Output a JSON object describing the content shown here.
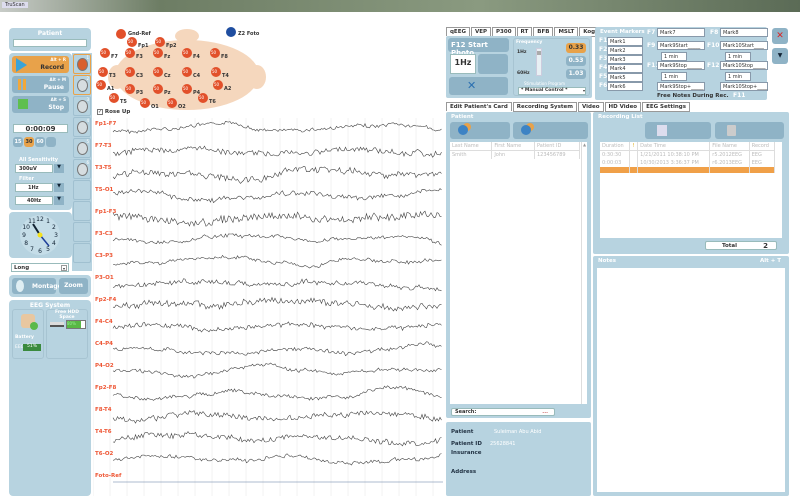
{
  "window": {
    "title": "TruScan"
  },
  "left": {
    "patient_label": "Patient",
    "patient_value": "",
    "record": {
      "label": "Record",
      "shortcut": "Alt + R"
    },
    "pause": {
      "label": "Pause",
      "shortcut": "Alt + M"
    },
    "stop": {
      "label": "Stop",
      "shortcut": "Alt + S"
    },
    "timer": "0:00:09",
    "timebase": [
      "15",
      "30",
      "60",
      ""
    ],
    "timebase_selected": "30",
    "sensitivity_label": "All Sensitivity",
    "sensitivity": "300uV",
    "filter_label": "Filter",
    "low_filter": "1Hz",
    "high_filter": "40Hz",
    "clock_numbers": [
      "12",
      "1",
      "2",
      "3",
      "4",
      "5",
      "6",
      "7",
      "8",
      "9",
      "10",
      "11"
    ],
    "mode": "Long",
    "montage": "Montage",
    "zoom": "Zoom",
    "eeg_system": "EEG System",
    "battery_label": "Battery",
    "battery_value": "51%",
    "battery_prefix": "EEG",
    "hdd_label": "Free HDD Space",
    "hdd_value": "80%"
  },
  "montage_icons": [
    "1",
    "2",
    "3",
    "4",
    "5",
    "6"
  ],
  "head": {
    "gnd": "Gnd-Ref",
    "foto": "Z2 Foto",
    "rose_up": "Rose Up",
    "rose_up_checked": true,
    "electrodes": [
      "Fp1",
      "Fp2",
      "F7",
      "F3",
      "Fz",
      "F4",
      "F8",
      "T3",
      "C3",
      "Cz",
      "C4",
      "T4",
      "A1",
      "P3",
      "Pz",
      "P4",
      "A2",
      "T5",
      "T6",
      "O1",
      "O2"
    ],
    "electrode_value": "50"
  },
  "channels": [
    "Fp1-F7",
    "F7-T3",
    "T3-T5",
    "T5-O1",
    "Fp1-F3",
    "F3-C3",
    "C3-P3",
    "P3-O1",
    "Fp2-F4",
    "F4-C4",
    "C4-P4",
    "P4-O2",
    "Fp2-F8",
    "F8-T4",
    "T4-T6",
    "T6-O2",
    "Foto-Ref"
  ],
  "stim": {
    "tabs": [
      "qEEG",
      "VEP",
      "P300",
      "RT",
      "BFB",
      "MSLT",
      "Kogn."
    ],
    "photo": "F12 Start Photo",
    "freq_value": "1Hz",
    "frequency_label": "Frequency",
    "freq_min": "1Hz",
    "freq_max": "60Hz",
    "values": [
      "0.33",
      "0.53",
      "1.03"
    ],
    "selected": "0.33",
    "program_label": "Stimulation Program",
    "program": "* Manual Control *"
  },
  "markers": {
    "title": "Event Markers",
    "keys": [
      "F1",
      "F2",
      "F3",
      "F4",
      "F5",
      "F6"
    ],
    "items": [
      "Mark1",
      "Mark2",
      "Mark3",
      "Mark4",
      "Mark5",
      "Mark6"
    ],
    "f7": "F7",
    "mark7": "Mark7",
    "f8": "F8",
    "mark8": "Mark8",
    "f9": "F9",
    "mark9start": "Mark9Start_____",
    "f10": "F10",
    "mark10start": "Mark10Start____",
    "dur": "1 min",
    "f11a": "F11",
    "mark9stop": "Mark9Stop______",
    "f12a": "F12",
    "mark10stop": "Mark10Stop_____",
    "mark9stopp": "Mark9Stop+_____",
    "mark10stopp": "Mark10Stop+____",
    "free_notes": "Free Notes During Rec.",
    "free_key": "F11"
  },
  "tabs": [
    "Edit Patient's Card",
    "Recording System",
    "Video",
    "HD Video",
    "EEG Settings"
  ],
  "patient_panel": {
    "title": "Patient",
    "columns": [
      "Last Name",
      "First Name",
      "Patient ID"
    ],
    "rows": [
      [
        "Smith",
        "John",
        "123456789"
      ]
    ],
    "search_label": "Search:",
    "search_value": "..."
  },
  "recording": {
    "title": "Recording List",
    "columns": [
      "Duration",
      "!",
      "Date Time",
      "File Name",
      "Record"
    ],
    "rows": [
      [
        "0:30:30",
        "",
        "1/21/2011 10:38:10 PM",
        "r5.2012EEG",
        "EEG"
      ],
      [
        "0:00:03",
        "",
        "10/30/2013 3:36:37 PM",
        "r6.2013EEG",
        "EEG"
      ],
      [
        "",
        "",
        "",
        "",
        ""
      ]
    ],
    "total_label": "Total",
    "total": "2"
  },
  "notes": {
    "title": "Notes",
    "shortcut": "Alt + T"
  },
  "info": {
    "patient_label": "Patient",
    "patient": "Suleiman Abu Abid",
    "id_label": "Patient ID",
    "id": "25628841",
    "insurance_label": "Insurance",
    "address_label": "Address"
  }
}
